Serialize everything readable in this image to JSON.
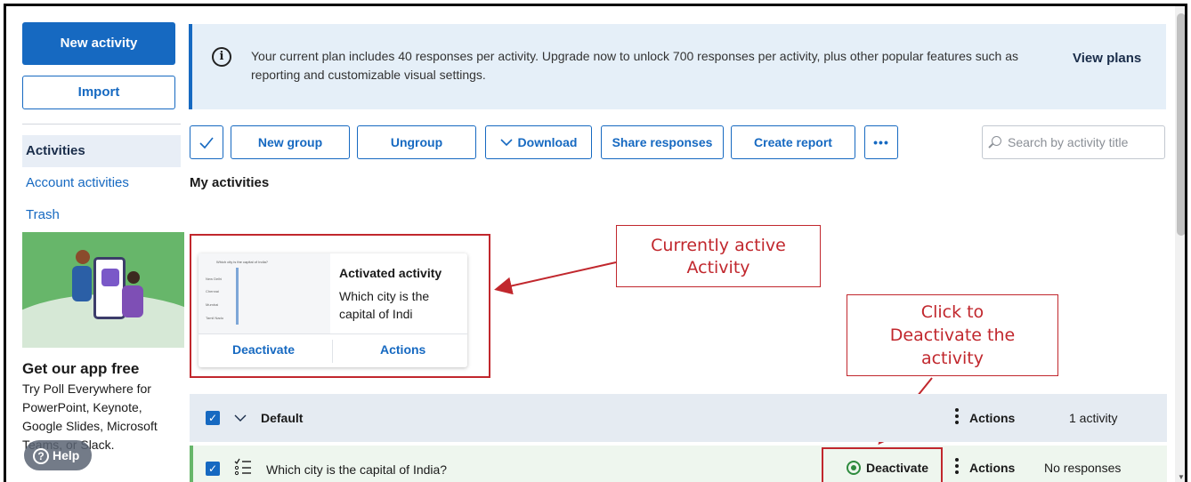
{
  "sidebar": {
    "new_activity": "New activity",
    "import": "Import",
    "nav": [
      {
        "label": "Activities",
        "active": true
      },
      {
        "label": "Account activities",
        "active": false
      },
      {
        "label": "Trash",
        "active": false
      }
    ],
    "promo": {
      "title": "Get our app free",
      "body": "Try Poll Everywhere for PowerPoint, Keynote, Google Slides, Microsoft Teams, or Slack."
    },
    "help": "Help"
  },
  "banner": {
    "text": "Your current plan includes 40 responses per activity. Upgrade now to unlock 700 responses per activity, plus other popular features such as reporting and customizable visual settings.",
    "view_plans": "View plans"
  },
  "toolbar": {
    "new_group": "New group",
    "ungroup": "Ungroup",
    "download": "Download",
    "share_responses": "Share responses",
    "create_report": "Create report",
    "more": "•••"
  },
  "search": {
    "placeholder": "Search by activity title"
  },
  "section_title": "My activities",
  "active_card": {
    "title": "Activated activity",
    "subtitle": "Which city is the capital of Indi",
    "thumb_question": "Which city is the capital of India?",
    "thumb_options": [
      "New Delhi",
      "Chennai",
      "Mumbai",
      "Tamil Nadu"
    ],
    "deactivate": "Deactivate",
    "actions": "Actions"
  },
  "annotations": {
    "active_callout": "Currently active Activity",
    "deactivate_callout": "Click to Deactivate the activity"
  },
  "group": {
    "name": "Default",
    "actions": "Actions",
    "count": "1 activity"
  },
  "activity": {
    "title": "Which city is the capital of India?",
    "deactivate": "Deactivate",
    "actions": "Actions",
    "responses": "No responses"
  },
  "colors": {
    "brand": "#1669c1",
    "annotation": "#c1272d",
    "active_row": "#eef6ee",
    "banner": "#e5eff8"
  }
}
